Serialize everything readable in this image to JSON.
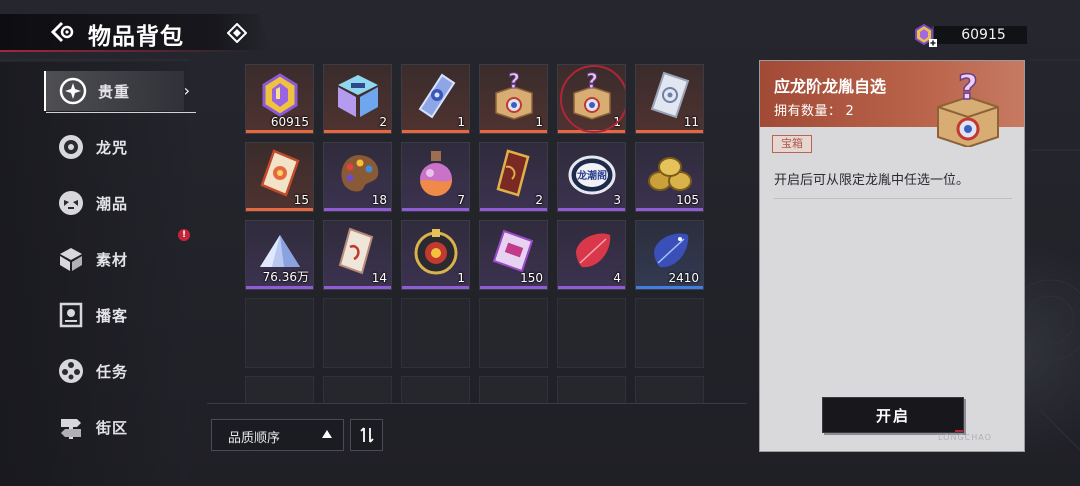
{
  "header": {
    "title": "物品背包"
  },
  "currency": {
    "amount": "60915",
    "icon": "purple-gem-plus-icon"
  },
  "sidebar": {
    "items": [
      {
        "label": "贵重",
        "icon": "sparkle-star-icon",
        "active": true
      },
      {
        "label": "龙咒",
        "icon": "ring-disc-icon"
      },
      {
        "label": "潮品",
        "icon": "mask-badge-icon"
      },
      {
        "label": "素材",
        "icon": "cube-box-icon",
        "badge": "!"
      },
      {
        "label": "播客",
        "icon": "podcast-frame-icon"
      },
      {
        "label": "任务",
        "icon": "film-reel-icon"
      },
      {
        "label": "街区",
        "icon": "street-sign-icon"
      }
    ]
  },
  "inventory": {
    "items": [
      {
        "name": "gold-purple-gem",
        "qty": "60915",
        "rarity": "orange"
      },
      {
        "name": "holo-cube",
        "qty": "2",
        "rarity": "orange"
      },
      {
        "name": "blue-crystal-token",
        "qty": "1",
        "rarity": "orange"
      },
      {
        "name": "mystery-box",
        "qty": "1",
        "rarity": "orange"
      },
      {
        "name": "mystery-box-selected",
        "qty": "1",
        "rarity": "orange",
        "selected": true
      },
      {
        "name": "silver-card",
        "qty": "11",
        "rarity": "orange"
      },
      {
        "name": "orange-ticket-card",
        "qty": "15",
        "rarity": "orange"
      },
      {
        "name": "paint-palette",
        "qty": "18",
        "rarity": "purple"
      },
      {
        "name": "potion-flask",
        "qty": "7",
        "rarity": "purple"
      },
      {
        "name": "gold-scroll-card",
        "qty": "2",
        "rarity": "purple"
      },
      {
        "name": "longchaoge-badge",
        "qty": "3",
        "rarity": "purple"
      },
      {
        "name": "gold-coins",
        "qty": "105",
        "rarity": "purple"
      },
      {
        "name": "crystal-pile",
        "qty": "76.36万",
        "rarity": "purple"
      },
      {
        "name": "paper-ticket",
        "qty": "14",
        "rarity": "purple"
      },
      {
        "name": "chip-token",
        "qty": "1",
        "rarity": "purple"
      },
      {
        "name": "pink-ticket",
        "qty": "150",
        "rarity": "purple"
      },
      {
        "name": "red-leaf-gem",
        "qty": "4",
        "rarity": "purple"
      },
      {
        "name": "blue-leaf-gem",
        "qty": "2410",
        "rarity": "blue"
      }
    ],
    "badge_text": "龙潮阁"
  },
  "sort": {
    "label": "品质顺序"
  },
  "detail": {
    "name": "应龙阶龙胤自选",
    "owned_label": "拥有数量：",
    "owned_value": "2",
    "tag": "宝箱",
    "description": "开启后可从限定龙胤中任选一位。",
    "open_button": "开启",
    "watermark": "LONGCHAO"
  },
  "colors": {
    "accent_red": "#b0253a",
    "rarity_orange": "#e5683f",
    "rarity_purple": "#8f5cd6",
    "rarity_blue": "#3f7fe0"
  }
}
